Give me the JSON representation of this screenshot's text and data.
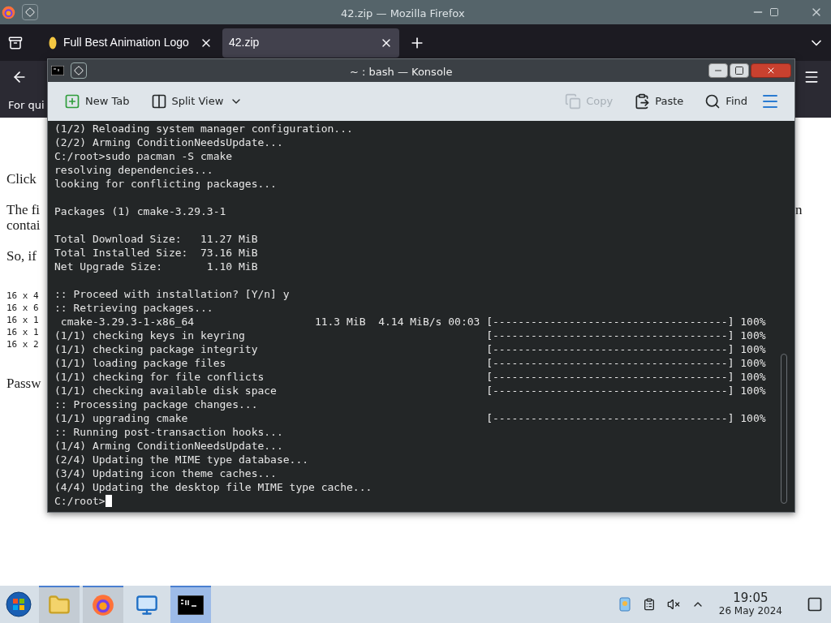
{
  "firefox": {
    "title": "42.zip — Mozilla Firefox",
    "tabs": [
      {
        "label": "Full Best Animation Logo",
        "selected": false
      },
      {
        "label": "42.zip",
        "selected": true
      }
    ],
    "bookmarks_text": "For qui",
    "page": {
      "paragraphs": [
        {
          "kind": "text",
          "lines": [
            "Click"
          ]
        },
        {
          "kind": "text",
          "lines": [
            "The fi",
            "contai"
          ]
        },
        {
          "kind": "text",
          "lines": [
            "So, if"
          ]
        },
        {
          "kind": "mono",
          "lines": [
            "16 x 4",
            "16 x 6",
            "16 x 1",
            "16 x 1",
            "16 x 2"
          ]
        },
        {
          "kind": "text",
          "lines": [
            "Passw"
          ]
        }
      ],
      "right_fragment": "n"
    }
  },
  "konsole": {
    "title": "~ : bash — Konsole",
    "toolbar": [
      {
        "kind": "new-tab",
        "label": "New Tab",
        "disabled": false
      },
      {
        "kind": "split-view",
        "label": "Split View",
        "disabled": false
      },
      {
        "kind": "copy",
        "label": "Copy",
        "disabled": true
      },
      {
        "kind": "paste",
        "label": "Paste",
        "disabled": false
      },
      {
        "kind": "find",
        "label": "Find",
        "disabled": false
      }
    ],
    "terminal": {
      "blocks": [
        [
          "(1/2) Reloading system manager configuration...",
          "(2/2) Arming ConditionNeedsUpdate...",
          "C:/root>sudo pacman -S cmake",
          "resolving dependencies...",
          "looking for conflicting packages..."
        ],
        [
          "Packages (1) cmake-3.29.3-1"
        ],
        [
          "Total Download Size:   11.27 MiB",
          "Total Installed Size:  73.16 MiB",
          "Net Upgrade Size:       1.10 MiB"
        ],
        [
          ":: Proceed with installation? [Y/n] y",
          ":: Retrieving packages...",
          " cmake-3.29.3-1-x86_64                   11.3 MiB  4.14 MiB/s 00:03 [-------------------------------------] 100%",
          "(1/1) checking keys in keyring                                      [-------------------------------------] 100%",
          "(1/1) checking package integrity                                    [-------------------------------------] 100%",
          "(1/1) loading package files                                         [-------------------------------------] 100%",
          "(1/1) checking for file conflicts                                   [-------------------------------------] 100%",
          "(1/1) checking available disk space                                 [-------------------------------------] 100%",
          ":: Processing package changes...",
          "(1/1) upgrading cmake                                               [-------------------------------------] 100%",
          ":: Running post-transaction hooks...",
          "(1/4) Arming ConditionNeedsUpdate...",
          "(2/4) Updating the MIME type database...",
          "(3/4) Updating icon theme caches...",
          "(4/4) Updating the desktop file MIME type cache..."
        ]
      ],
      "prompt": "C:/root>"
    }
  },
  "taskbar": {
    "apps": [
      {
        "kind": "folder",
        "open": true,
        "selected": false
      },
      {
        "kind": "firefox",
        "open": true,
        "selected": false
      },
      {
        "kind": "monitor",
        "open": false,
        "selected": false
      },
      {
        "kind": "terminal",
        "open": true,
        "selected": true
      }
    ],
    "clock": {
      "time": "19:05",
      "date": "26 May 2024"
    }
  }
}
